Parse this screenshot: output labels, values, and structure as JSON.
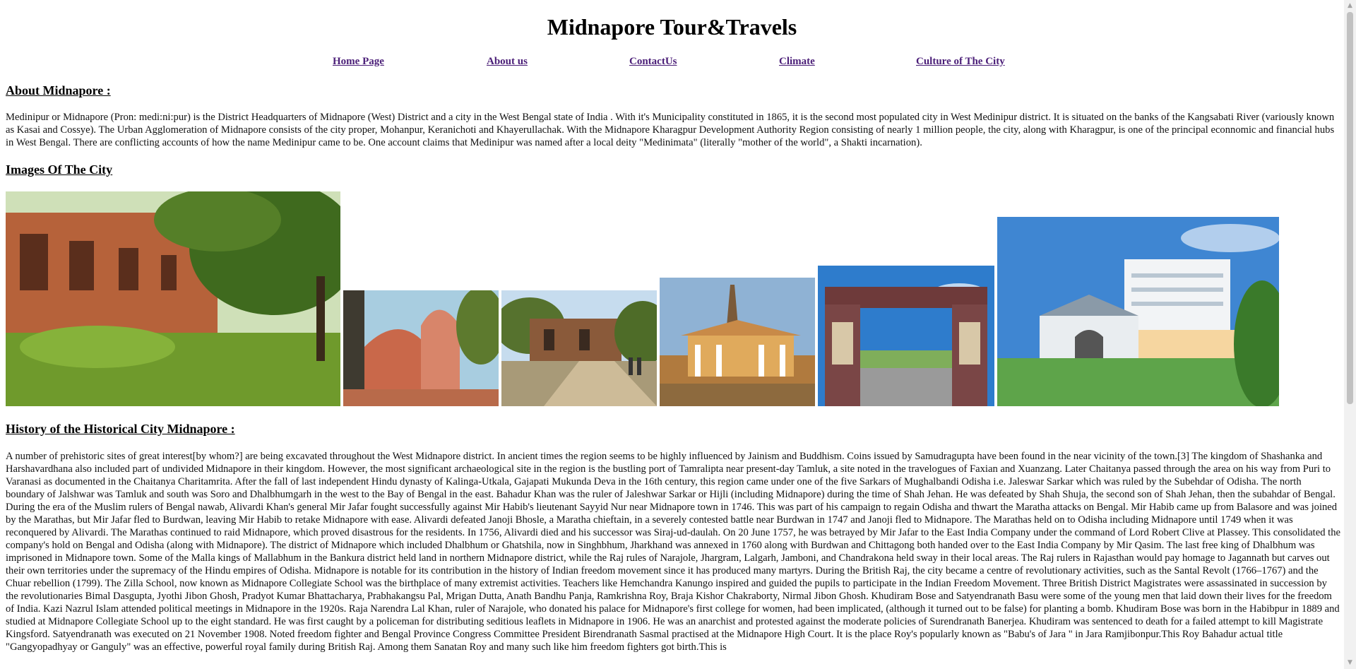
{
  "site": {
    "title": "Midnapore Tour&Travels"
  },
  "nav": {
    "items": [
      {
        "label": "Home Page"
      },
      {
        "label": "About us"
      },
      {
        "label": "ContactUs"
      },
      {
        "label": "Climate"
      },
      {
        "label": "Culture of The City"
      }
    ]
  },
  "about": {
    "heading": "About Midnapore :",
    "text": "Medinipur or Midnapore (Pron: medi:ni:pur) is the District Headquarters of Midnapore (West) District and a city in the West Bengal state of India . With it's Municipality constituted in 1865, it is the second most populated city in West Medinipur district. It is situated on the banks of the Kangsabati River (variously known as Kasai and Cossye). The Urban Agglomeration of Midnapore consists of the city proper, Mohanpur, Keranichoti and Khayerullachak. With the Midnapore Kharagpur Development Authority Region consisting of nearly 1 million people, the city, along with Kharagpur, is one of the principal econnomic and financial hubs in West Bengal. There are conflicting accounts of how the name Medinipur came to be. One account claims that Medinipur was named after a local deity \"Medinimata\" (literally \"mother of the world\", a Shakti incarnation)."
  },
  "images": {
    "heading": "Images Of The City",
    "photos": [
      {
        "subject": "ruined-brick-palace",
        "colors": [
          "#c46a3c",
          "#6a8a2c"
        ]
      },
      {
        "subject": "terracotta-temple",
        "colors": [
          "#c86a46",
          "#9fc8de"
        ]
      },
      {
        "subject": "fort-ruins-with-visitors",
        "colors": [
          "#8a5a3a",
          "#b9d2e8"
        ]
      },
      {
        "subject": "colonial-church",
        "colors": [
          "#d8a05a",
          "#7aa0c8"
        ]
      },
      {
        "subject": "memorial-gate",
        "colors": [
          "#7a4a4a",
          "#2f78c8"
        ]
      },
      {
        "subject": "college-building",
        "colors": [
          "#eef2f6",
          "#3f86d2"
        ]
      }
    ]
  },
  "history": {
    "heading": "History of the Historical City Midnapore :",
    "text": "A number of prehistoric sites of great interest[by whom?] are being excavated throughout the West Midnapore district. In ancient times the region seems to be highly influenced by Jainism and Buddhism. Coins issued by Samudragupta have been found in the near vicinity of the town.[3] The kingdom of Shashanka and Harshavardhana also included part of undivided Midnapore in their kingdom. However, the most significant archaeological site in the region is the bustling port of Tamralipta near present-day Tamluk, a site noted in the travelogues of Faxian and Xuanzang. Later Chaitanya passed through the area on his way from Puri to Varanasi as documented in the Chaitanya Charitamrita. After the fall of last independent Hindu dynasty of Kalinga-Utkala, Gajapati Mukunda Deva in the 16th century, this region came under one of the five Sarkars of Mughalbandi Odisha i.e. Jaleswar Sarkar which was ruled by the Subehdar of Odisha. The north boundary of Jalshwar was Tamluk and south was Soro and Dhalbhumgarh in the west to the Bay of Bengal in the east. Bahadur Khan was the ruler of Jaleshwar Sarkar or Hijli (including Midnapore) during the time of Shah Jehan. He was defeated by Shah Shuja, the second son of Shah Jehan, then the subahdar of Bengal. During the era of the Muslim rulers of Bengal nawab, Alivardi Khan's general Mir Jafar fought successfully against Mir Habib's lieutenant Sayyid Nur near Midnapore town in 1746. This was part of his campaign to regain Odisha and thwart the Maratha attacks on Bengal. Mir Habib came up from Balasore and was joined by the Marathas, but Mir Jafar fled to Burdwan, leaving Mir Habib to retake Midnapore with ease. Alivardi defeated Janoji Bhosle, a Maratha chieftain, in a severely contested battle near Burdwan in 1747 and Janoji fled to Midnapore. The Marathas held on to Odisha including Midnapore until 1749 when it was reconquered by Alivardi. The Marathas continued to raid Midnapore, which proved disastrous for the residents. In 1756, Alivardi died and his successor was Siraj-ud-daulah. On 20 June 1757, he was betrayed by Mir Jafar to the East India Company under the command of Lord Robert Clive at Plassey. This consolidated the company's hold on Bengal and Odisha (along with Midnapore). The district of Midnapore which included Dhalbhum or Ghatshila, now in Singhbhum, Jharkhand was annexed in 1760 along with Burdwan and Chittagong both handed over to the East India Company by Mir Qasim. The last free king of Dhalbhum was imprisoned in Midnapore town. Some of the Malla kings of Mallabhum in the Bankura district held land in northern Midnapore district, while the Raj rules of Narajole, Jhargram, Lalgarh, Jamboni, and Chandrakona held sway in their local areas. The Raj rulers in Rajasthan would pay homage to Jagannath but carves out their own territories under the supremacy of the Hindu empires of Odisha. Midnapore is notable for its contribution in the history of Indian freedom movement since it has produced many martyrs. During the British Raj, the city became a centre of revolutionary activities, such as the Santal Revolt (1766–1767) and the Chuar rebellion (1799). The Zilla School, now known as Midnapore Collegiate School was the birthplace of many extremist activities. Teachers like Hemchandra Kanungo inspired and guided the pupils to participate in the Indian Freedom Movement. Three British District Magistrates were assassinated in succession by the revolutionaries Bimal Dasgupta, Jyothi Jibon Ghosh, Pradyot Kumar Bhattacharya, Prabhakangsu Pal, Mrigan Dutta, Anath Bandhu Panja, Ramkrishna Roy, Braja Kishor Chakraborty, Nirmal Jibon Ghosh. Khudiram Bose and Satyendranath Basu were some of the young men that laid down their lives for the freedom of India. Kazi Nazrul Islam attended political meetings in Midnapore in the 1920s. Raja Narendra Lal Khan, ruler of Narajole, who donated his palace for Midnapore's first college for women, had been implicated, (although it turned out to be false) for planting a bomb. Khudiram Bose was born in the Habibpur in 1889 and studied at Midnapore Collegiate School up to the eight standard. He was first caught by a policeman for distributing seditious leaflets in Midnapore in 1906. He was an anarchist and protested against the moderate policies of Surendranath Banerjea. Khudiram was sentenced to death for a failed attempt to kill Magistrate Kingsford. Satyendranath was executed on 21 November 1908. Noted freedom fighter and Bengal Province Congress Committee President Birendranath Sasmal practised at the Midnapore High Court. It is the place Roy's popularly known as \"Babu's of Jara \" in Jara Ramjibonpur.This Roy Bahadur actual title \"Gangyopadhyay or Ganguly\" was an effective, powerful royal family during British Raj. Among them Sanatan Roy and many such like him freedom fighters got birth.This is"
  },
  "scrollbar": {
    "up_icon": "▲",
    "down_icon": "▼"
  }
}
